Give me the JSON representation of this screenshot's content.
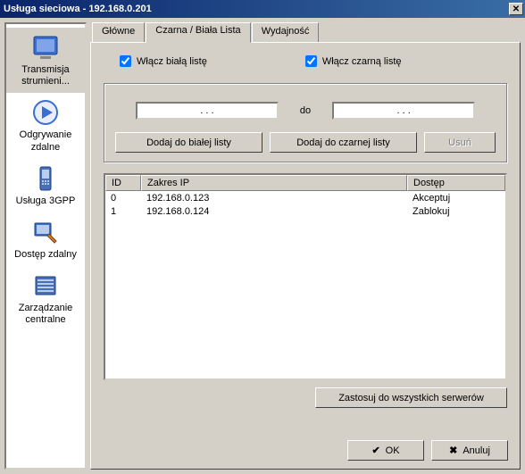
{
  "titlebar": {
    "title": "Usługa sieciowa - 192.168.0.201"
  },
  "sidebar": {
    "items": [
      {
        "label": "Transmisja strumieni..."
      },
      {
        "label": "Odgrywanie zdalne"
      },
      {
        "label": "Usługa 3GPP"
      },
      {
        "label": "Dostęp zdalny"
      },
      {
        "label": "Zarządzanie centralne"
      }
    ]
  },
  "tabs": {
    "main": "Główne",
    "list": "Czarna / Biała Lista",
    "perf": "Wydajność"
  },
  "checks": {
    "white": "Włącz białą listę",
    "black": "Włącz czarną listę"
  },
  "ip": {
    "blank": ".   .   .",
    "sep": "do"
  },
  "buttons": {
    "add_white": "Dodaj do białej listy",
    "add_black": "Dodaj do czarnej listy",
    "delete": "Usuń",
    "apply_all": "Zastosuj do wszystkich serwerów",
    "ok": "OK",
    "cancel": "Anuluj"
  },
  "list": {
    "headers": {
      "id": "ID",
      "ip": "Zakres IP",
      "acc": "Dostęp"
    },
    "rows": [
      {
        "id": "0",
        "ip": "192.168.0.123",
        "acc": "Akceptuj"
      },
      {
        "id": "1",
        "ip": "192.168.0.124",
        "acc": "Zablokuj"
      }
    ]
  }
}
